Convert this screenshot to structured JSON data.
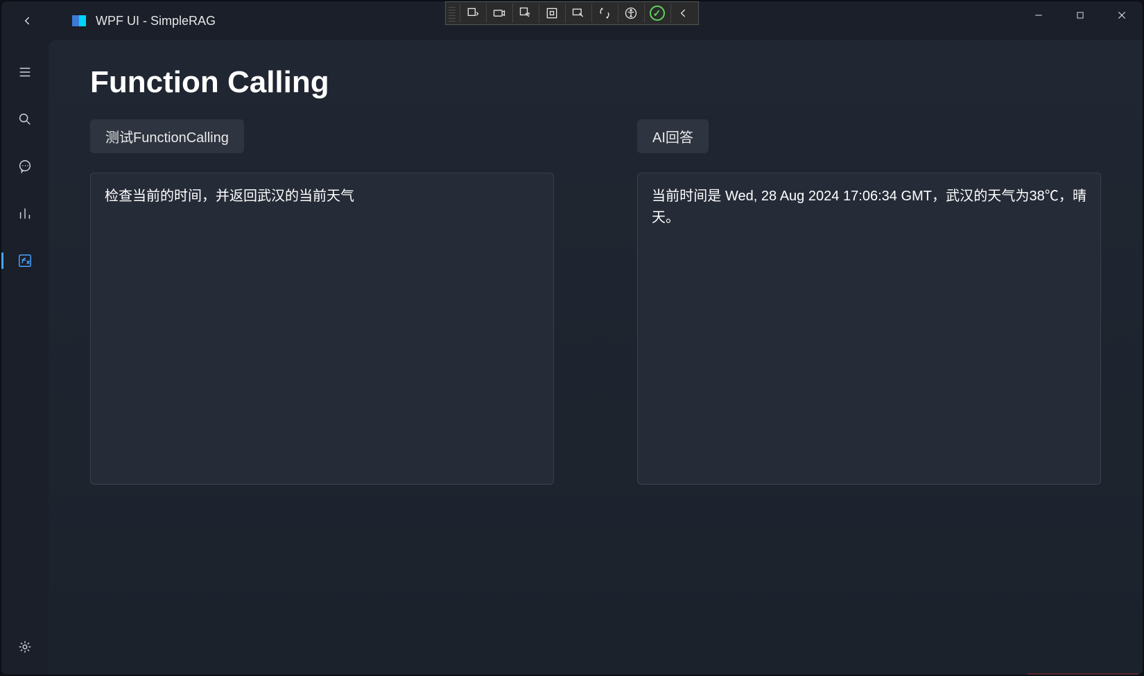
{
  "window": {
    "title": "WPF UI - SimpleRAG"
  },
  "page": {
    "heading": "Function Calling"
  },
  "left_panel": {
    "button_label": "测试FunctionCalling",
    "content": "检查当前的时间，并返回武汉的当前天气"
  },
  "right_panel": {
    "button_label": "AI回答",
    "content": "当前时间是 Wed, 28 Aug 2024 17:06:34 GMT，武汉的天气为38℃，晴天。"
  },
  "sidebar": {
    "items": [
      {
        "name": "menu",
        "icon": "menu"
      },
      {
        "name": "search",
        "icon": "search"
      },
      {
        "name": "chat",
        "icon": "chat"
      },
      {
        "name": "chart",
        "icon": "chart"
      },
      {
        "name": "function-calling",
        "icon": "fx",
        "active": true
      }
    ],
    "settings": {
      "icon": "gear"
    }
  },
  "vs_toolbar": {
    "items": [
      "live-tree",
      "camera",
      "cursor-select",
      "box-select",
      "rect-select",
      "hotreload",
      "accessibility",
      "status-ok",
      "collapse"
    ]
  }
}
